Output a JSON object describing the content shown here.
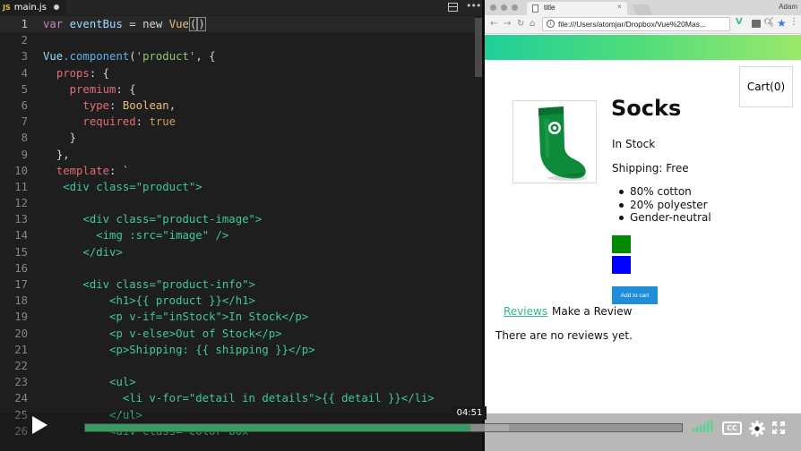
{
  "editor": {
    "tab": {
      "icon_text": "JS",
      "label": "main.js"
    },
    "more_label": "•••",
    "lines": [
      {
        "n": "1"
      },
      {
        "n": "2"
      },
      {
        "n": "3"
      },
      {
        "n": "4"
      },
      {
        "n": "5"
      },
      {
        "n": "6"
      },
      {
        "n": "7"
      },
      {
        "n": "8"
      },
      {
        "n": "9"
      },
      {
        "n": "10"
      },
      {
        "n": "11"
      },
      {
        "n": "12"
      },
      {
        "n": "13"
      },
      {
        "n": "14"
      },
      {
        "n": "15"
      },
      {
        "n": "16"
      },
      {
        "n": "17"
      },
      {
        "n": "18"
      },
      {
        "n": "19"
      },
      {
        "n": "20"
      },
      {
        "n": "21"
      },
      {
        "n": "22"
      },
      {
        "n": "23"
      },
      {
        "n": "24"
      },
      {
        "n": "25"
      },
      {
        "n": "26"
      }
    ],
    "code": {
      "l1_var": "var",
      "l1_name": "eventBus",
      "l1_eq": " = ",
      "l1_new": "new",
      "l1_vue": "Vue",
      "l1_paren_open": "(",
      "l1_paren_close": ")",
      "l3_vue": "Vue",
      "l3_component": ".component",
      "l3_open": "(",
      "l3_str": "'product'",
      "l3_rest": ", {",
      "l4_props": "props",
      "l4_rest": ": {",
      "l5_premium": "premium",
      "l5_rest": ": {",
      "l6_type": "type",
      "l6_colon": ": ",
      "l6_boolean": "Boolean",
      "l6_comma": ",",
      "l7_required": "required",
      "l7_colon": ": ",
      "l7_true": "true",
      "l8": "}",
      "l9": "},",
      "l10_template": "template",
      "l10_rest": ": `",
      "l11": "<div class=\"product\">",
      "l13": "<div class=\"product-image\">",
      "l14": "<img :src=\"image\" />",
      "l15": "</div>",
      "l17": "<div class=\"product-info\">",
      "l18": "<h1>{{ product }}</h1>",
      "l19": "<p v-if=\"inStock\">In Stock</p>",
      "l20": "<p v-else>Out of Stock</p>",
      "l21": "<p>Shipping: {{ shipping }}</p>",
      "l23": "<ul>",
      "l24": "<li v-for=\"detail in details\">{{ detail }}</li>",
      "l25": "</ul>",
      "l26": "<div class=\"color-box\""
    }
  },
  "browser": {
    "tab_title": "title",
    "tab_close": "×",
    "profile": "Adam",
    "nav": {
      "back": "←",
      "forward": "→",
      "reload": "↻",
      "home": "⌂"
    },
    "url": "file:///Users/atomjar/Dropbox/Vue%20Mas...",
    "extension_label": "V",
    "menu": "⋮",
    "page": {
      "cart_label": "Cart(0)",
      "product_name": "Socks",
      "stock_text": "In Stock",
      "shipping_text": "Shipping: Free",
      "details": [
        "80% cotton",
        "20% polyester",
        "Gender-neutral"
      ],
      "swatches": [
        {
          "color": "#008a00"
        },
        {
          "color": "#0000ff"
        }
      ],
      "add_to_cart": "Add to cart",
      "tabs": [
        "Reviews",
        "Make a Review"
      ],
      "no_reviews": "There are no reviews yet."
    }
  },
  "player": {
    "time_tooltip": "04:51",
    "progress_fraction": 0.645,
    "buffered_fraction": 0.71,
    "cc_label": "CC",
    "accent_color": "#3a9a66"
  }
}
